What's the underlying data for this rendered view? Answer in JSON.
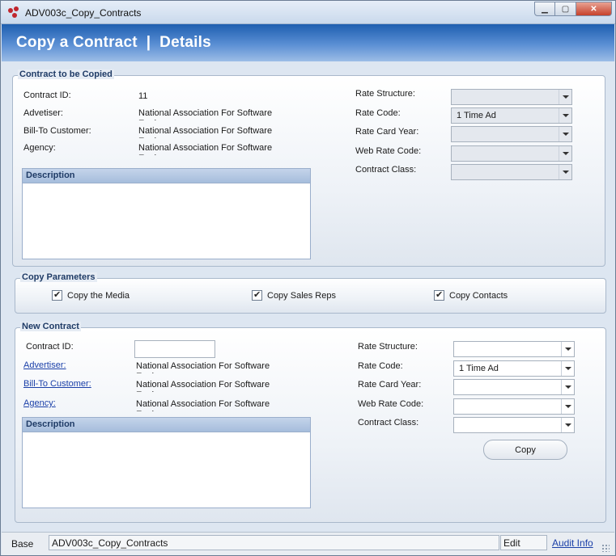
{
  "window": {
    "title": "ADV003c_Copy_Contracts"
  },
  "header": {
    "title": "Copy a Contract  |  Details"
  },
  "source": {
    "group_label": "Contract to be Copied",
    "contract_id_label": "Contract ID:",
    "contract_id_value": "11",
    "advertiser_label": "Advetiser:",
    "advertiser_value": "National Association For Software Engineers",
    "bill_to_label": "Bill-To Customer:",
    "bill_to_value": "National Association For Software Engineers",
    "agency_label": "Agency:",
    "agency_value": "National Association For Software Engineers",
    "description_header": "Description",
    "rate_structure_label": "Rate Structure:",
    "rate_structure_value": "",
    "rate_code_label": "Rate Code:",
    "rate_code_value": "1 Time Ad",
    "rate_card_year_label": "Rate Card Year:",
    "rate_card_year_value": "",
    "web_rate_code_label": "Web Rate Code:",
    "web_rate_code_value": "",
    "contract_class_label": "Contract Class:",
    "contract_class_value": ""
  },
  "params": {
    "group_label": "Copy Parameters",
    "copy_media_label": "Copy the Media",
    "copy_sales_reps_label": "Copy Sales Reps",
    "copy_contacts_label": "Copy Contacts"
  },
  "new_contract": {
    "group_label": "New Contract",
    "contract_id_label": "Contract ID:",
    "contract_id_value": "",
    "advertiser_label": "Advertiser:",
    "advertiser_value": "National Association For Software Engineers",
    "bill_to_label": "Bill-To Customer:",
    "bill_to_value": "National Association For Software Engineers",
    "agency_label": "Agency:",
    "agency_value": "National Association For Software Engineers",
    "description_header": "Description",
    "rate_structure_label": "Rate Structure:",
    "rate_structure_value": "",
    "rate_code_label": "Rate Code:",
    "rate_code_value": "1 Time Ad",
    "rate_card_year_label": "Rate Card Year:",
    "rate_card_year_value": "",
    "web_rate_code_label": "Web Rate Code:",
    "web_rate_code_value": "",
    "contract_class_label": "Contract Class:",
    "contract_class_value": "",
    "copy_button_label": "Copy"
  },
  "statusbar": {
    "base_label": "Base",
    "form_name": "ADV003c_Copy_Contracts",
    "mode": "Edit",
    "audit_link": "Audit Info"
  }
}
